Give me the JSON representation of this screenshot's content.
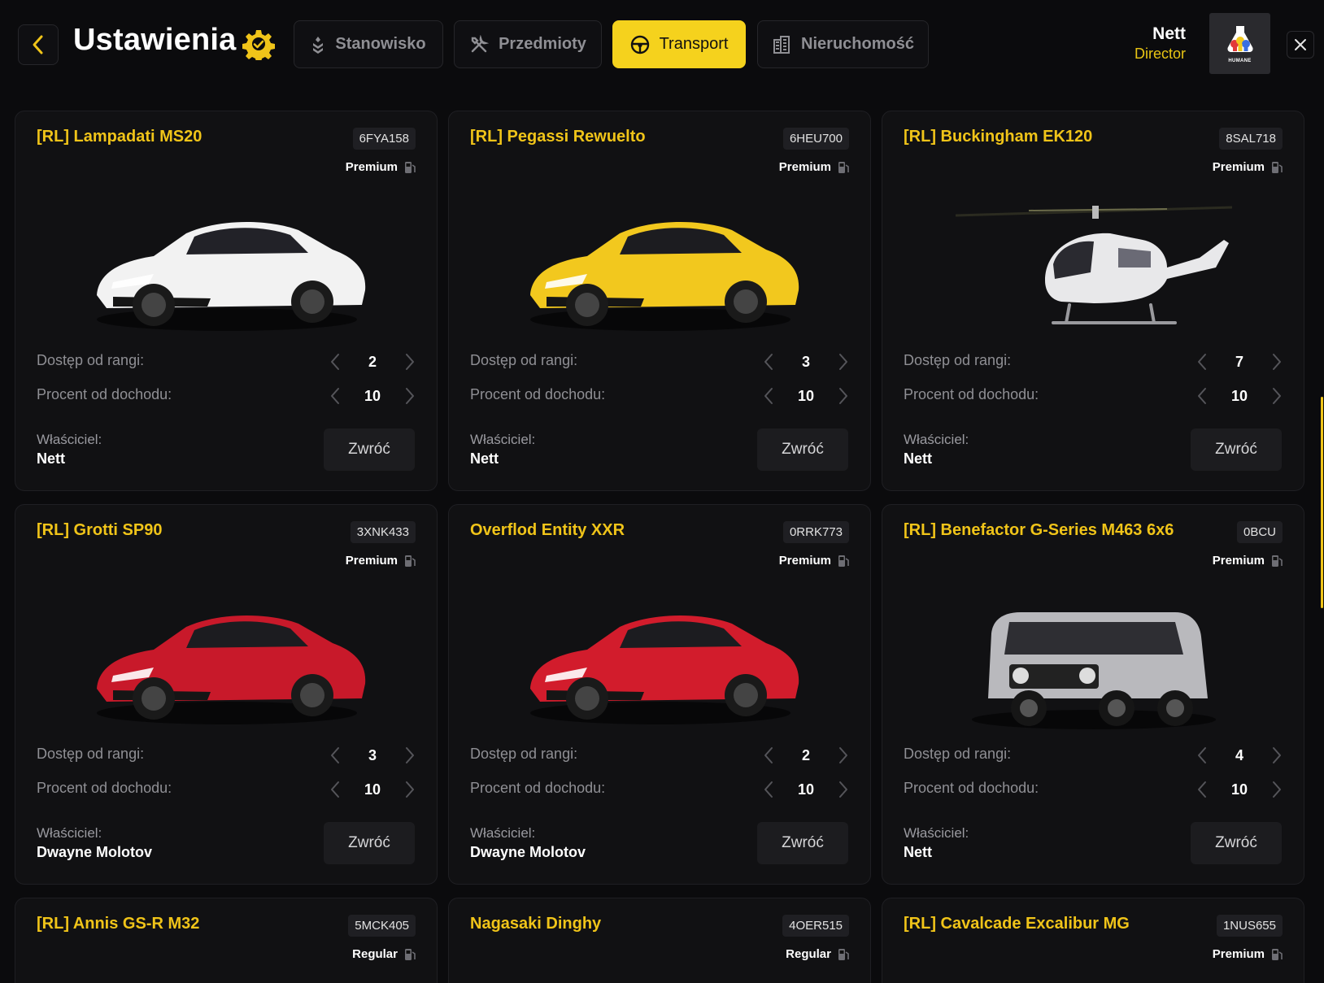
{
  "header": {
    "title": "Ustawienia",
    "tabs": [
      {
        "label": "Stanowisko",
        "icon": "rank-icon",
        "active": false
      },
      {
        "label": "Przedmioty",
        "icon": "tools-icon",
        "active": false
      },
      {
        "label": "Transport",
        "icon": "steering-wheel-icon",
        "active": true
      },
      {
        "label": "Nieruchomość",
        "icon": "building-icon",
        "active": false
      }
    ],
    "user": {
      "name": "Nett",
      "role": "Director",
      "avatar_brand": "HUMANE"
    }
  },
  "labels": {
    "rank": "Dostęp od rangi:",
    "percent": "Procent od dochodu:",
    "owner": "Właściciel:",
    "return": "Zwróć"
  },
  "colors": {
    "accent": "#f5d21d",
    "card_bg": "#111113",
    "page_bg": "#0b0b0d"
  },
  "vehicles": [
    {
      "name": "[RL] Lampadati MS20",
      "plate": "6FYA158",
      "class": "Premium",
      "rank": "2",
      "percent": "10",
      "owner": "Nett",
      "image": "white-supercar",
      "color": "#f2f2f2"
    },
    {
      "name": "[RL] Pegassi Rewuelto",
      "plate": "6HEU700",
      "class": "Premium",
      "rank": "3",
      "percent": "10",
      "owner": "Nett",
      "image": "yellow-supercar",
      "color": "#f2c81e"
    },
    {
      "name": "[RL] Buckingham EK120",
      "plate": "8SAL718",
      "class": "Premium",
      "rank": "7",
      "percent": "10",
      "owner": "Nett",
      "image": "white-helicopter",
      "color": "#e8e8ea"
    },
    {
      "name": "[RL] Grotti SP90",
      "plate": "3XNK433",
      "class": "Premium",
      "rank": "3",
      "percent": "10",
      "owner": "Dwayne Molotov",
      "image": "red-supercar",
      "color": "#c8192a"
    },
    {
      "name": "Overflod Entity XXR",
      "plate": "0RRK773",
      "class": "Premium",
      "rank": "2",
      "percent": "10",
      "owner": "Dwayne Molotov",
      "image": "red-hypercar",
      "color": "#d21c2c"
    },
    {
      "name": "[RL] Benefactor G-Series M463 6x6",
      "plate": "0BCU",
      "class": "Premium",
      "rank": "4",
      "percent": "10",
      "owner": "Nett",
      "image": "silver-6x6-suv",
      "color": "#b9b9bd"
    },
    {
      "name": "[RL] Annis GS-R M32",
      "plate": "5MCK405",
      "class": "Regular"
    },
    {
      "name": "Nagasaki Dinghy",
      "plate": "4OER515",
      "class": "Regular"
    },
    {
      "name": "[RL] Cavalcade Excalibur MG",
      "plate": "1NUS655",
      "class": "Premium"
    }
  ]
}
